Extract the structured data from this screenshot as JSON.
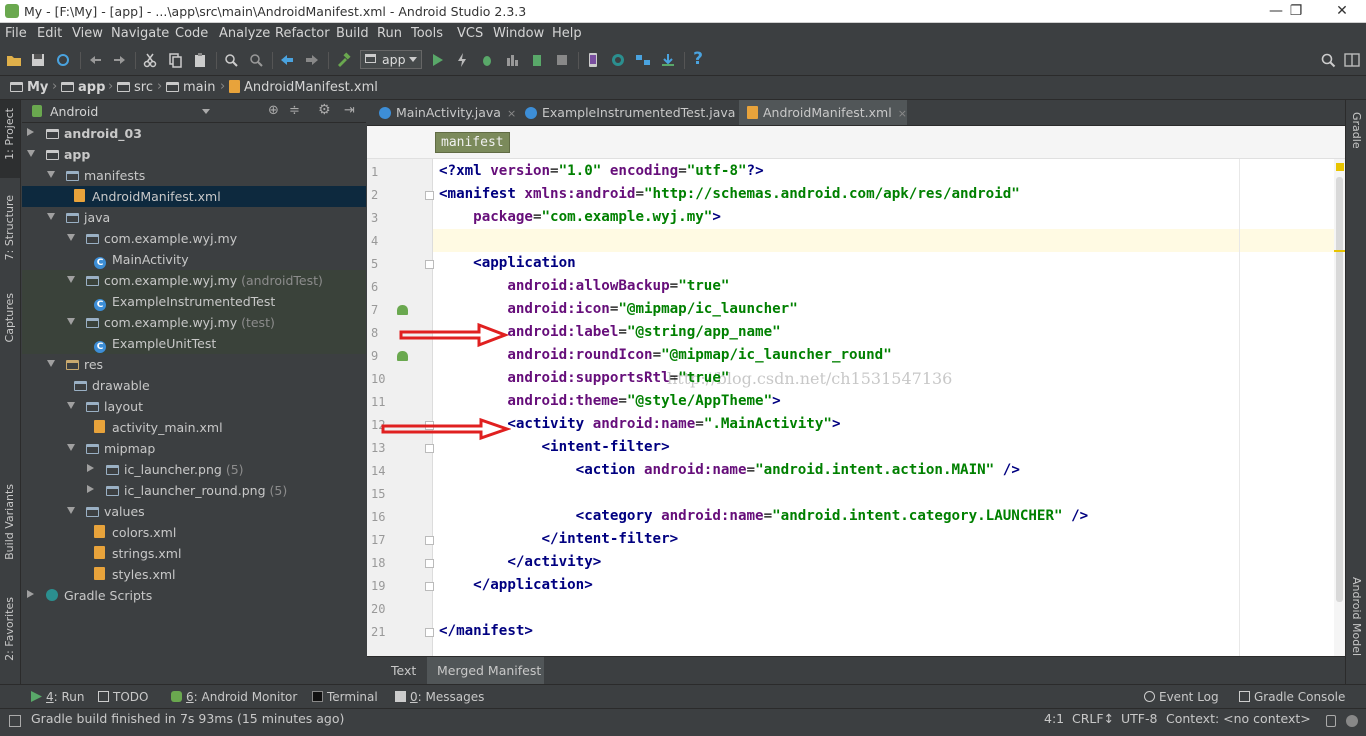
{
  "window": {
    "title": "My - [F:\\My] - [app] - ...\\app\\src\\main\\AndroidManifest.xml - Android Studio 2.3.3",
    "minimize": "—",
    "restore": "❐",
    "close": "✕"
  },
  "menu": [
    "File",
    "Edit",
    "View",
    "Navigate",
    "Code",
    "Analyze",
    "Refactor",
    "Build",
    "Run",
    "Tools",
    "VCS",
    "Window",
    "Help"
  ],
  "toolbar": {
    "run_config": "app",
    "help": "?"
  },
  "breadcrumb": [
    "My",
    "app",
    "src",
    "main",
    "AndroidManifest.xml"
  ],
  "left_strip": [
    "1: Project",
    "7: Structure",
    "Captures",
    "Build Variants",
    "2: Favorites"
  ],
  "right_strip": [
    "Gradle",
    "Android Model"
  ],
  "project_panel": {
    "view": "Android",
    "tree": [
      {
        "label": "android_03",
        "suffix": "",
        "depth": 0,
        "arrow": "right",
        "icon": "module-icon",
        "bold": true
      },
      {
        "label": "app",
        "suffix": "",
        "depth": 0,
        "arrow": "down",
        "icon": "module-icon",
        "bold": true
      },
      {
        "label": "manifests",
        "suffix": "",
        "depth": 1,
        "arrow": "down",
        "icon": "folder-icon"
      },
      {
        "label": "AndroidManifest.xml",
        "suffix": "",
        "depth": 2,
        "arrow": "",
        "icon": "xml-file-icon",
        "selected": true
      },
      {
        "label": "java",
        "suffix": "",
        "depth": 1,
        "arrow": "down",
        "icon": "folder-icon"
      },
      {
        "label": "com.example.wyj.my",
        "suffix": "",
        "depth": 2,
        "arrow": "down",
        "icon": "package-icon"
      },
      {
        "label": "MainActivity",
        "suffix": "",
        "depth": 3,
        "arrow": "",
        "icon": "class-icon"
      },
      {
        "label": "com.example.wyj.my",
        "suffix": "(androidTest)",
        "depth": 2,
        "arrow": "down",
        "icon": "package-icon",
        "tinted": true
      },
      {
        "label": "ExampleInstrumentedTest",
        "suffix": "",
        "depth": 3,
        "arrow": "",
        "icon": "class-icon",
        "tinted": true
      },
      {
        "label": "com.example.wyj.my",
        "suffix": "(test)",
        "depth": 2,
        "arrow": "down",
        "icon": "package-icon",
        "tinted": true
      },
      {
        "label": "ExampleUnitTest",
        "suffix": "",
        "depth": 3,
        "arrow": "",
        "icon": "class-icon",
        "tinted": true
      },
      {
        "label": "res",
        "suffix": "",
        "depth": 1,
        "arrow": "down",
        "icon": "res-folder-icon"
      },
      {
        "label": "drawable",
        "suffix": "",
        "depth": 2,
        "arrow": "",
        "icon": "folder-icon"
      },
      {
        "label": "layout",
        "suffix": "",
        "depth": 2,
        "arrow": "down",
        "icon": "folder-icon"
      },
      {
        "label": "activity_main.xml",
        "suffix": "",
        "depth": 3,
        "arrow": "",
        "icon": "xml-file-icon"
      },
      {
        "label": "mipmap",
        "suffix": "",
        "depth": 2,
        "arrow": "down",
        "icon": "folder-icon"
      },
      {
        "label": "ic_launcher.png",
        "suffix": "(5)",
        "depth": 3,
        "arrow": "right",
        "icon": "folder-icon"
      },
      {
        "label": "ic_launcher_round.png",
        "suffix": "(5)",
        "depth": 3,
        "arrow": "right",
        "icon": "folder-icon"
      },
      {
        "label": "values",
        "suffix": "",
        "depth": 2,
        "arrow": "down",
        "icon": "folder-icon"
      },
      {
        "label": "colors.xml",
        "suffix": "",
        "depth": 3,
        "arrow": "",
        "icon": "xml-file-icon"
      },
      {
        "label": "strings.xml",
        "suffix": "",
        "depth": 3,
        "arrow": "",
        "icon": "xml-file-icon"
      },
      {
        "label": "styles.xml",
        "suffix": "",
        "depth": 3,
        "arrow": "",
        "icon": "xml-file-icon"
      },
      {
        "label": "Gradle Scripts",
        "suffix": "",
        "depth": 0,
        "arrow": "right",
        "icon": "gradle-icon"
      }
    ]
  },
  "editor_tabs": [
    {
      "label": "MainActivity.java",
      "icon": "class-icon",
      "active": false
    },
    {
      "label": "ExampleInstrumentedTest.java",
      "icon": "class-icon",
      "active": false
    },
    {
      "label": "AndroidManifest.xml",
      "icon": "xml-file-icon",
      "active": true
    }
  ],
  "editor": {
    "crumb": "manifest",
    "watermark": "http://blog.csdn.net/ch1531547136",
    "lines": [
      [
        [
          "tg",
          "<?xml "
        ],
        [
          "at",
          "version"
        ],
        [
          "pl",
          "="
        ],
        [
          "av",
          "\"1.0\""
        ],
        [
          "pl",
          " "
        ],
        [
          "at",
          "encoding"
        ],
        [
          "pl",
          "="
        ],
        [
          "av",
          "\"utf-8\""
        ],
        [
          "tg",
          "?>"
        ]
      ],
      [
        [
          "tg",
          "<manifest "
        ],
        [
          "at",
          "xmlns:android"
        ],
        [
          "pl",
          "="
        ],
        [
          "av",
          "\"http://schemas.android.com/apk/res/android\""
        ]
      ],
      [
        [
          "pl",
          "    "
        ],
        [
          "at",
          "package"
        ],
        [
          "pl",
          "="
        ],
        [
          "av",
          "\"com.example.wyj.my\""
        ],
        [
          "tg",
          ">"
        ]
      ],
      [],
      [
        [
          "pl",
          "    "
        ],
        [
          "tg",
          "<application"
        ]
      ],
      [
        [
          "pl",
          "        "
        ],
        [
          "at",
          "android:allowBackup"
        ],
        [
          "pl",
          "="
        ],
        [
          "av",
          "\"true\""
        ]
      ],
      [
        [
          "pl",
          "        "
        ],
        [
          "at",
          "android:icon"
        ],
        [
          "pl",
          "="
        ],
        [
          "av",
          "\"@mipmap/ic_launcher\""
        ]
      ],
      [
        [
          "pl",
          "        "
        ],
        [
          "at",
          "android:label"
        ],
        [
          "pl",
          "="
        ],
        [
          "av",
          "\"@string/app_name\""
        ]
      ],
      [
        [
          "pl",
          "        "
        ],
        [
          "at",
          "android:roundIcon"
        ],
        [
          "pl",
          "="
        ],
        [
          "av",
          "\"@mipmap/ic_launcher_round\""
        ]
      ],
      [
        [
          "pl",
          "        "
        ],
        [
          "at",
          "android:supportsRtl"
        ],
        [
          "pl",
          "="
        ],
        [
          "av",
          "\"true\""
        ]
      ],
      [
        [
          "pl",
          "        "
        ],
        [
          "at",
          "android:theme"
        ],
        [
          "pl",
          "="
        ],
        [
          "av",
          "\"@style/AppTheme\""
        ],
        [
          "tg",
          ">"
        ]
      ],
      [
        [
          "pl",
          "        "
        ],
        [
          "tg",
          "<activity "
        ],
        [
          "at",
          "android:name"
        ],
        [
          "pl",
          "="
        ],
        [
          "av",
          "\".MainActivity\""
        ],
        [
          "tg",
          ">"
        ]
      ],
      [
        [
          "pl",
          "            "
        ],
        [
          "tg",
          "<intent-filter>"
        ]
      ],
      [
        [
          "pl",
          "                "
        ],
        [
          "tg",
          "<action "
        ],
        [
          "at",
          "android:name"
        ],
        [
          "pl",
          "="
        ],
        [
          "av",
          "\"android.intent.action.MAIN\""
        ],
        [
          "pl",
          " "
        ],
        [
          "tg",
          "/>"
        ]
      ],
      [],
      [
        [
          "pl",
          "                "
        ],
        [
          "tg",
          "<category "
        ],
        [
          "at",
          "android:name"
        ],
        [
          "pl",
          "="
        ],
        [
          "av",
          "\"android.intent.category.LAUNCHER\""
        ],
        [
          "pl",
          " "
        ],
        [
          "tg",
          "/>"
        ]
      ],
      [
        [
          "pl",
          "            "
        ],
        [
          "tg",
          "</intent-filter>"
        ]
      ],
      [
        [
          "pl",
          "        "
        ],
        [
          "tg",
          "</activity>"
        ]
      ],
      [
        [
          "pl",
          "    "
        ],
        [
          "tg",
          "</application>"
        ]
      ],
      [],
      [
        [
          "tg",
          "</manifest>"
        ]
      ]
    ]
  },
  "editor_bottom_tabs": [
    "Text",
    "Merged Manifest"
  ],
  "tool_windows": {
    "left": [
      {
        "key": "4",
        "label": ": Run"
      },
      {
        "key": "",
        "label": "TODO"
      },
      {
        "key": "6",
        "label": ": Android Monitor"
      },
      {
        "key": "",
        "label": "Terminal"
      },
      {
        "key": "0",
        "label": ": Messages"
      }
    ],
    "right": [
      "Event Log",
      "Gradle Console"
    ]
  },
  "status": {
    "message": "Gradle build finished in 7s 93ms (15 minutes ago)",
    "position": "4:1",
    "line_sep": "CRLF↕",
    "encoding": "UTF-8",
    "context": "Context: <no context>"
  },
  "colors": {
    "tag": "#000080",
    "attr": "#660e7a",
    "value": "#008000",
    "annotation_arrow": "#e02020"
  }
}
